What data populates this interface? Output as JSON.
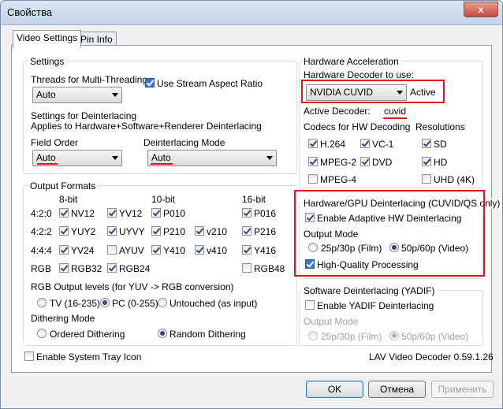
{
  "window": {
    "title": "Свойства",
    "close_glyph": "x"
  },
  "tabs": [
    {
      "label": "Video Settings"
    },
    {
      "label": "Pin Info"
    }
  ],
  "settings": {
    "title": "Settings",
    "threads_label": "Threads for Multi-Threading",
    "threads_value": "Auto",
    "aspect_label": "Use Stream Aspect Ratio",
    "deint_line1": "Settings for Deinterlacing",
    "deint_line2": "Applies to Hardware+Software+Renderer Deinterlacing",
    "field_order_label": "Field Order",
    "field_order_value": "Auto",
    "deint_mode_label": "Deinterlacing Mode",
    "deint_mode_value": "Auto"
  },
  "output_formats": {
    "title": "Output Formats",
    "col_8bit": "8-bit",
    "col_10bit": "10-bit",
    "col_16bit": "16-bit",
    "rows": [
      "4:2:0",
      "4:2:2",
      "4:4:4",
      "RGB"
    ],
    "f": {
      "nv12": "NV12",
      "yv12": "YV12",
      "p010": "P010",
      "p016": "P016",
      "yuy2": "YUY2",
      "uyvy": "UYVY",
      "p210": "P210",
      "v210": "v210",
      "p216": "P216",
      "yv24": "YV24",
      "ayuv": "AYUV",
      "y410": "Y410",
      "v410": "v410",
      "y416": "Y416",
      "rgb32": "RGB32",
      "rgb24": "RGB24",
      "rgb48": "RGB48"
    },
    "rgb_levels_label": "RGB Output levels (for YUV -> RGB conversion)",
    "tv": "TV (16-235)",
    "pc": "PC (0-255)",
    "untouched": "Untouched (as input)",
    "dither_label": "Dithering Mode",
    "ordered": "Ordered Dithering",
    "random": "Random Dithering"
  },
  "hw_accel": {
    "title": "Hardware Acceleration",
    "decoder_label": "Hardware Decoder to use:",
    "decoder_value": "NVIDIA CUVID",
    "decoder_status": "Active",
    "active_decoder_label": "Active Decoder:",
    "active_decoder_value": "cuvid",
    "codecs_label": "Codecs for HW Decoding",
    "resolutions_label": "Resolutions",
    "h264": "H.264",
    "vc1": "VC-1",
    "mpeg2": "MPEG-2",
    "dvd": "DVD",
    "mpeg4": "MPEG-4",
    "sd": "SD",
    "hd": "HD",
    "uhd": "UHD (4K)"
  },
  "hw_deint": {
    "title": "Hardware/GPU Deinterlacing (CUVID/QS only)",
    "enable": "Enable Adaptive HW Deinterlacing",
    "output_mode": "Output Mode",
    "film": "25p/30p (Film)",
    "video": "50p/60p (Video)",
    "hq": "High-Quality Processing"
  },
  "sw_deint": {
    "title": "Software Deinterlacing (YADIF)",
    "enable": "Enable YADIF Deinterlacing",
    "output_mode": "Output Mode",
    "film": "25p/30p (Film)",
    "video": "50p/60p (Video)"
  },
  "footer": {
    "tray": "Enable System Tray Icon",
    "version": "LAV Video Decoder 0.59.1.26",
    "ok": "OK",
    "cancel": "Отмена",
    "apply": "Применить"
  },
  "colors": {
    "annotation_red": "#d81a1a",
    "highlight_blue": "#3b78c6"
  }
}
